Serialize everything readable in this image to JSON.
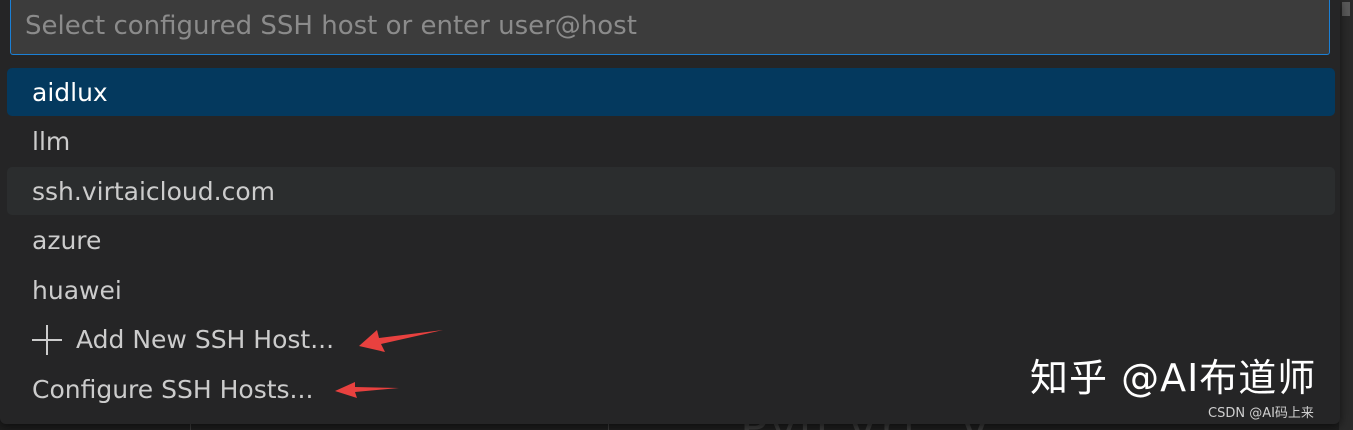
{
  "search": {
    "placeholder": "Select configured SSH host or enter user@host",
    "value": ""
  },
  "hosts": [
    {
      "label": "aidlux",
      "state": "selected"
    },
    {
      "label": "llm",
      "state": "normal"
    },
    {
      "label": "ssh.virtaicloud.com",
      "state": "hover"
    },
    {
      "label": "azure",
      "state": "normal"
    },
    {
      "label": "huawei",
      "state": "normal"
    }
  ],
  "actions": {
    "add_new": "Add New SSH Host...",
    "configure": "Configure SSH Hosts..."
  },
  "watermark": {
    "main": "知乎 @AI布道师",
    "small": "CSDN @AI码上来"
  },
  "colors": {
    "focus_border": "#1b80d6",
    "selected_bg": "#04395e",
    "arrow": "#e8413f"
  }
}
